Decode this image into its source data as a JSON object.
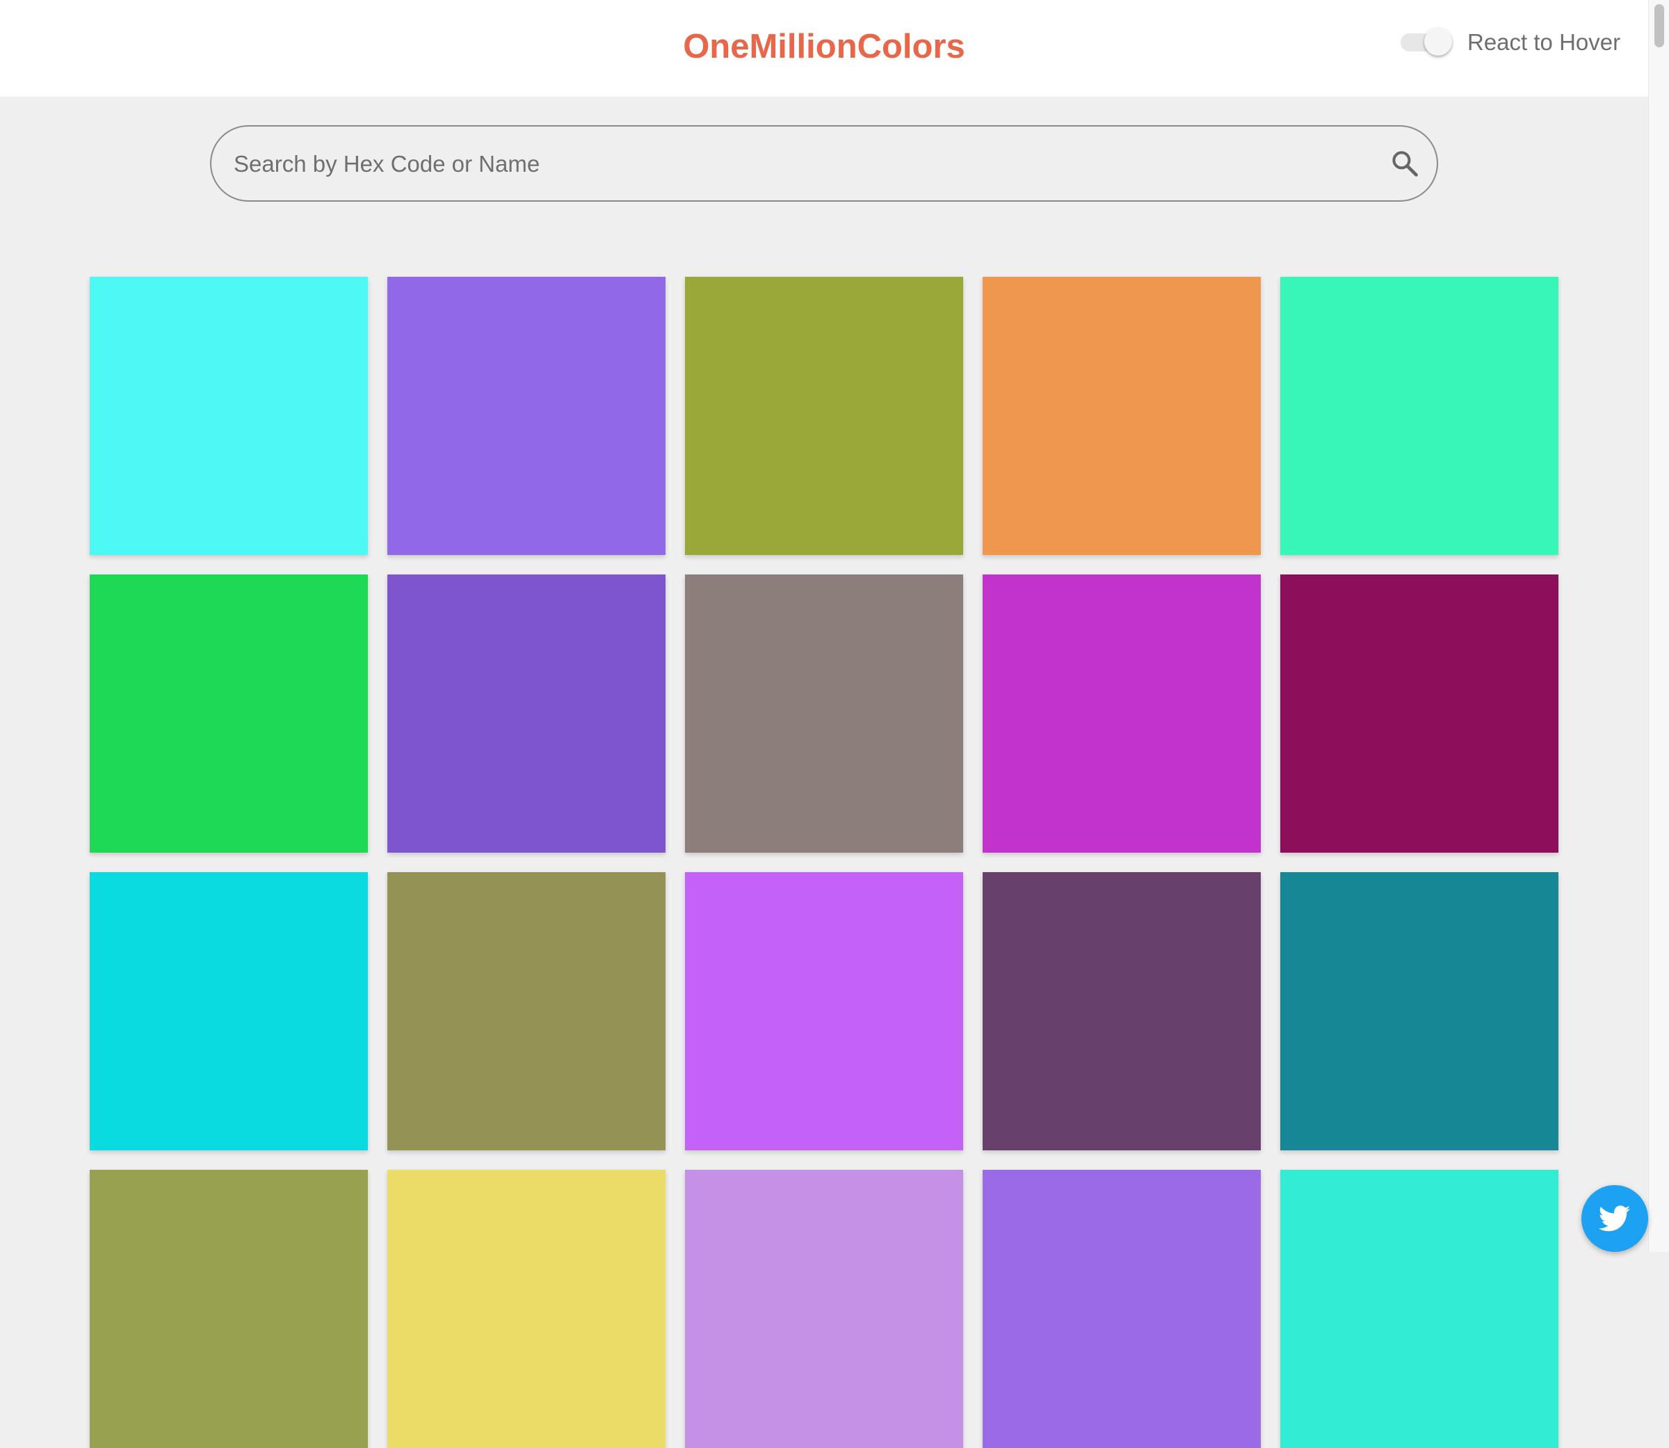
{
  "header": {
    "title": "OneMillionColors",
    "title_color": "#e8664a",
    "hover_toggle": {
      "label": "React to Hover",
      "enabled": false
    }
  },
  "search": {
    "placeholder": "Search by Hex Code or Name",
    "value": "",
    "icon": "search-icon"
  },
  "colors": [
    [
      "#4cf9f4",
      "#9169e8",
      "#9aa839",
      "#ef964f",
      "#37f6b7"
    ],
    [
      "#1dd955",
      "#7f54cf",
      "#8c7f7b",
      "#c232cc",
      "#8d0f5b"
    ],
    [
      "#0adbe1",
      "#949355",
      "#c462f7",
      "#67416b",
      "#168794"
    ],
    [
      "#98a14f",
      "#ebdc67",
      "#c591e6",
      "#9a6be6",
      "#32ecd4"
    ]
  ],
  "social": {
    "icon": "twitter-icon",
    "color": "#1da1f2"
  }
}
